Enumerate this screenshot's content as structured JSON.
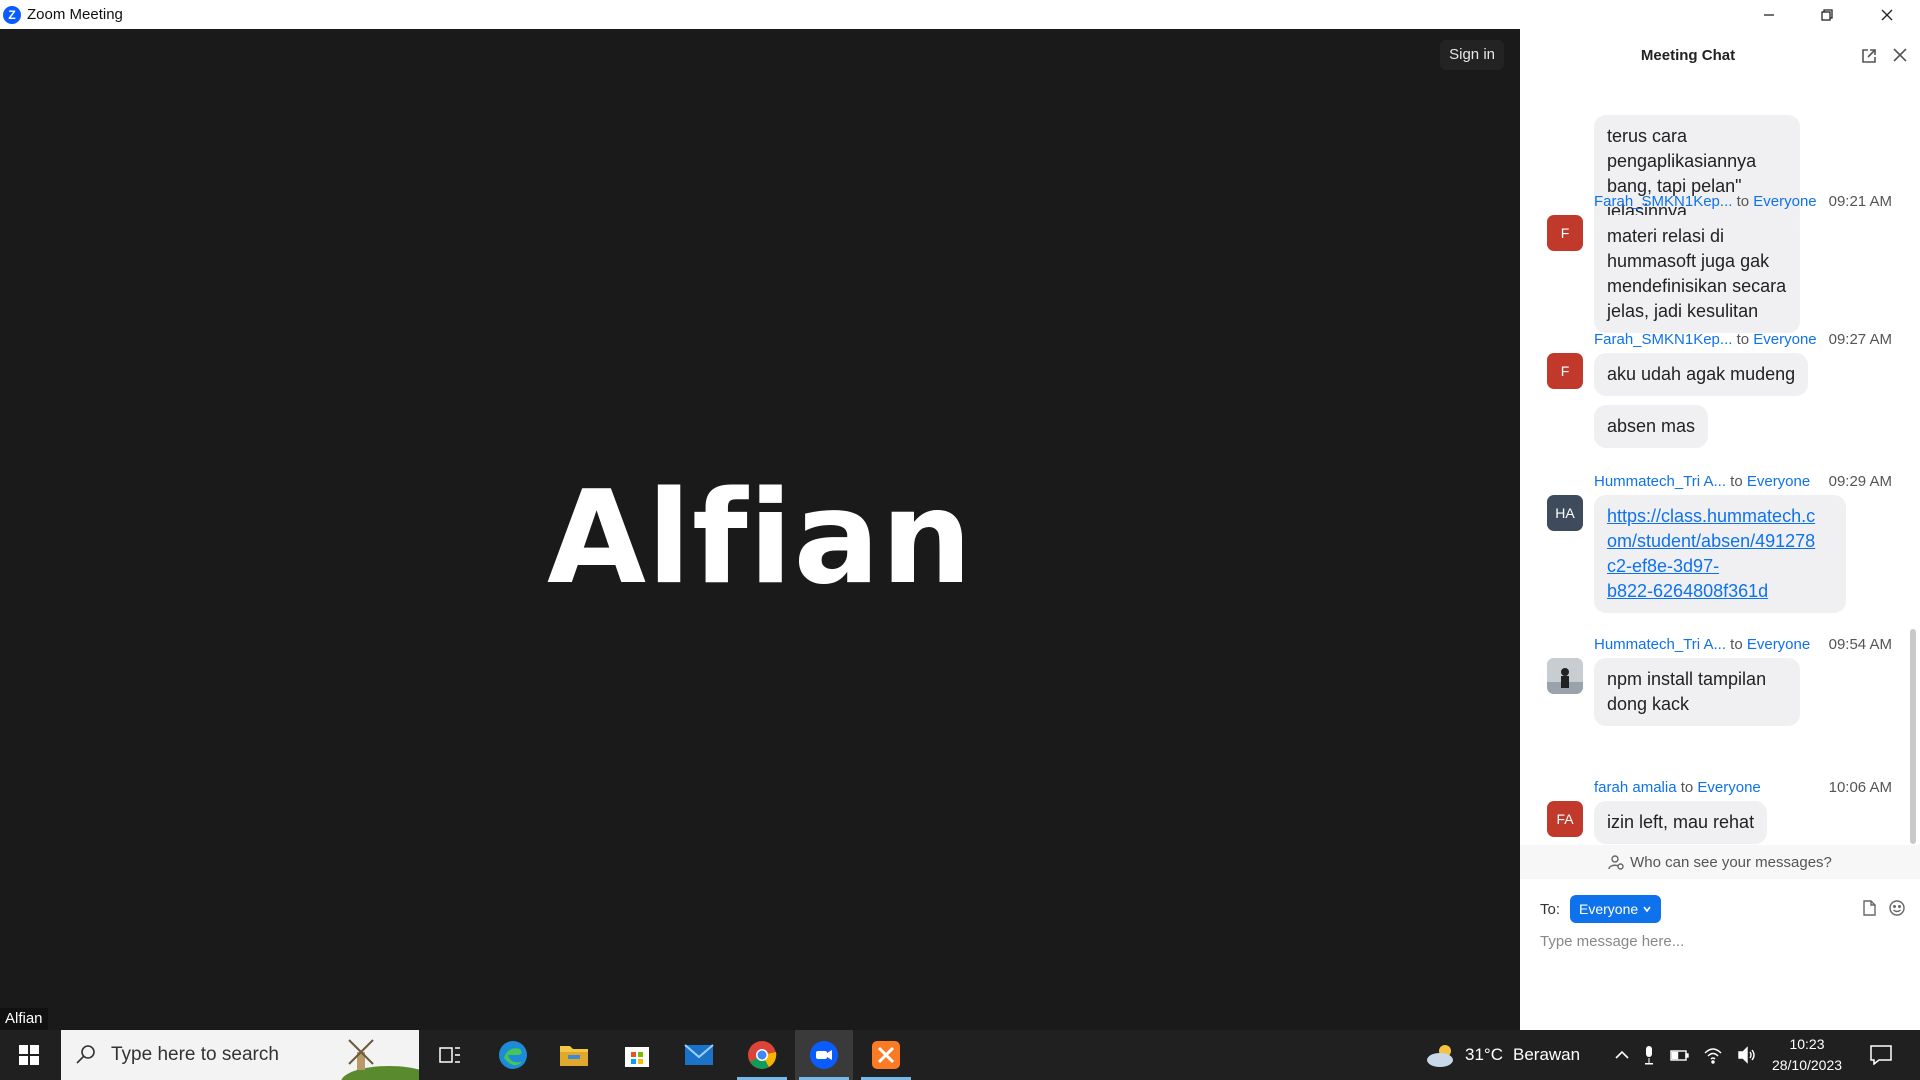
{
  "window": {
    "title": "Zoom Meeting",
    "logo_letter": "Z"
  },
  "video": {
    "sign_in": "Sign in",
    "participant_display": "Alfian",
    "name_tag": "Alfian"
  },
  "chat": {
    "title": "Meeting Chat",
    "messages": [
      {
        "text": "terus cara pengaplikasiannya bang, tapi pelan\" jelasinnya"
      },
      {
        "sender": "Farah_SMKN1Kep...",
        "to_word": "to",
        "recipient": "Everyone",
        "time": "09:21 AM",
        "avatar": "F",
        "text": "materi relasi di hummasoft juga gak mendefinisikan secara jelas, jadi kesulitan"
      },
      {
        "sender": "Farah_SMKN1Kep...",
        "to_word": "to",
        "recipient": "Everyone",
        "time": "09:27 AM",
        "avatar": "F",
        "text": "aku udah agak mudeng"
      },
      {
        "text": "absen mas"
      },
      {
        "sender": "Hummatech_Tri A...",
        "to_word": "to",
        "recipient": "Everyone",
        "time": "09:29 AM",
        "avatar": "HA",
        "text": "https://class.hummatech.com/student/absen/491278c2-ef8e-3d97-b822-6264808f361d"
      },
      {
        "sender": "Hummatech_Tri A...",
        "to_word": "to",
        "recipient": "Everyone",
        "time": "09:54 AM",
        "text": "npm install tampilan dong kack"
      },
      {
        "sender": "farah amalia",
        "to_word": "to",
        "recipient": "Everyone",
        "time": "10:06 AM",
        "avatar": "FA",
        "text": "izin left, mau rehat"
      }
    ],
    "link_lines": [
      "https://class.hummatech.c",
      "om/student/absen/491278",
      "c2-ef8e-3d97-",
      "b822-6264808f361d"
    ],
    "who_can_see": "Who can see your messages?",
    "to_label": "To:",
    "to_value": "Everyone",
    "input_placeholder": "Type message here..."
  },
  "taskbar": {
    "search_placeholder": "Type here to search",
    "weather_temp": "31°C",
    "weather_desc": "Berawan",
    "time": "10:23",
    "date": "28/10/2023"
  },
  "colors": {
    "accent": "#0e72ed",
    "avatar_red": "#c0392b",
    "avatar_slate": "#3d4b5c",
    "video_bg": "#1a1a1a"
  }
}
